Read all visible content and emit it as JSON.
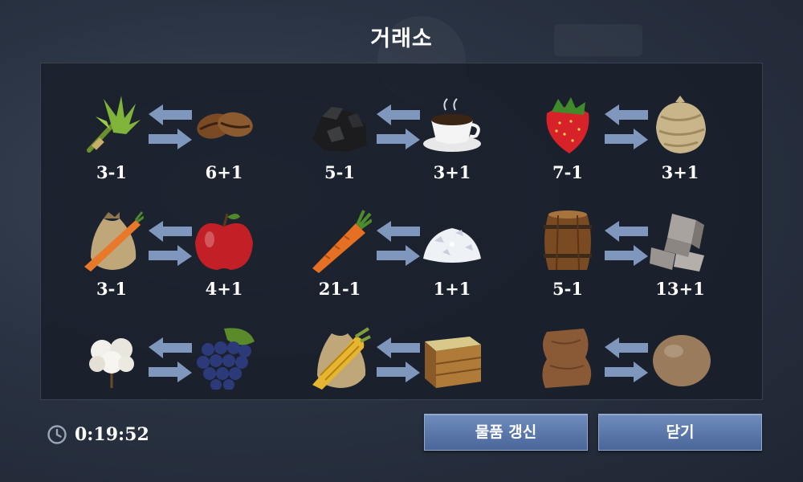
{
  "title": "거래소",
  "trades": [
    {
      "left": {
        "icon": "herb-icon",
        "label": "3-1"
      },
      "right": {
        "icon": "coffee-beans-icon",
        "label": "6+1"
      }
    },
    {
      "left": {
        "icon": "coal-icon",
        "label": "5-1"
      },
      "right": {
        "icon": "coffee-cup-icon",
        "label": "3+1"
      }
    },
    {
      "left": {
        "icon": "strawberry-icon",
        "label": "7-1"
      },
      "right": {
        "icon": "wool-bundle-icon",
        "label": "3+1"
      }
    },
    {
      "left": {
        "icon": "carrot-sack-icon",
        "label": "3-1"
      },
      "right": {
        "icon": "apple-icon",
        "label": "4+1"
      }
    },
    {
      "left": {
        "icon": "carrot-icon",
        "label": "21-1"
      },
      "right": {
        "icon": "salt-icon",
        "label": "1+1"
      }
    },
    {
      "left": {
        "icon": "barrel-icon",
        "label": "5-1"
      },
      "right": {
        "icon": "iron-ingot-icon",
        "label": "13+1"
      }
    },
    {
      "left": {
        "icon": "cotton-icon",
        "label": ""
      },
      "right": {
        "icon": "grapes-icon",
        "label": ""
      }
    },
    {
      "left": {
        "icon": "corn-sack-icon",
        "label": ""
      },
      "right": {
        "icon": "wooden-crate-icon",
        "label": ""
      }
    },
    {
      "left": {
        "icon": "leather-icon",
        "label": ""
      },
      "right": {
        "icon": "egg-icon",
        "label": ""
      }
    }
  ],
  "timer": {
    "icon": "clock-icon",
    "value": "0:19:52"
  },
  "buttons": {
    "refresh_label": "물품 갱신",
    "close_label": "닫기"
  },
  "colors": {
    "button": "#5a78ad",
    "panel": "#171d28",
    "arrow": "#7f97bd"
  }
}
